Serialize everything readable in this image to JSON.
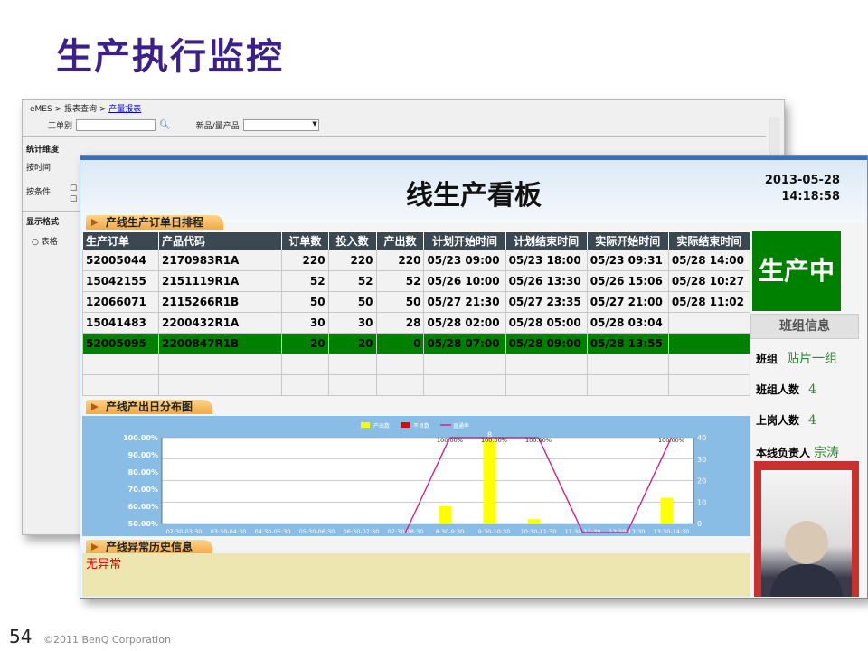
{
  "slide": {
    "title": "生产执行监控",
    "page_number": "54",
    "copyright": "©2011 BenQ Corporation"
  },
  "bg_window": {
    "breadcrumb_prefix": "eMES > 报表查询 > ",
    "breadcrumb_link": "产量报表",
    "order_label": "工单别",
    "product_label": "新品/量产品",
    "section_stats": "统计维度",
    "by_time": "按时间",
    "by_condition": "按条件",
    "section_display": "显示格式",
    "table_option": "表格"
  },
  "board": {
    "title": "线生产看板",
    "date": "2013-05-28",
    "time": "14:18:58",
    "schedule_tab": "产线生产订单日排程",
    "output_tab": "产线产出日分布图",
    "anomaly_tab": "产线异常历史信息",
    "anomaly_text": "无异常",
    "status": "生产中",
    "team_header": "班组信息",
    "team_label": "班组",
    "team_value": "贴片一组",
    "team_size_label": "班组人数",
    "team_size_value": "4",
    "onduty_label": "上岗人数",
    "onduty_value": "4",
    "owner_label": "本线负责人",
    "owner_value": "宗涛"
  },
  "orders": {
    "columns": [
      "生产订单",
      "产品代码",
      "订单数",
      "投入数",
      "产出数",
      "计划开始时间",
      "计划结束时间",
      "实际开始时间",
      "实际结束时间"
    ],
    "rows": [
      [
        "52005044",
        "2170983R1A",
        "220",
        "220",
        "220",
        "05/23 09:00",
        "05/23 18:00",
        "05/23 09:31",
        "05/28 14:00"
      ],
      [
        "15042155",
        "2151119R1A",
        "52",
        "52",
        "52",
        "05/26 10:00",
        "05/26 13:30",
        "05/26 15:06",
        "05/28 10:27"
      ],
      [
        "12066071",
        "2115266R1B",
        "50",
        "50",
        "50",
        "05/27 21:30",
        "05/27 23:35",
        "05/27 21:00",
        "05/28 11:02"
      ],
      [
        "15041483",
        "2200432R1A",
        "30",
        "30",
        "28",
        "05/28 02:00",
        "05/28 05:00",
        "05/28 03:04",
        ""
      ],
      [
        "52005095",
        "2200847R1B",
        "20",
        "20",
        "0",
        "05/28 07:00",
        "05/28 09:00",
        "05/28 13:55",
        ""
      ],
      [
        "",
        "",
        "",
        "",
        "",
        "",
        "",
        "",
        ""
      ],
      [
        "",
        "",
        "",
        "",
        "",
        "",
        "",
        "",
        ""
      ]
    ],
    "highlight_row": 4,
    "highlight_color": "#008000"
  },
  "chart_data": {
    "type": "bar",
    "categories": [
      "02:30-03:30",
      "03:30-04:30",
      "04:30-05:30",
      "05:30-06:30",
      "06:30-07:30",
      "07:30-08:30",
      "8:30-9:30",
      "9:30-10:30",
      "10:30-11:30",
      "11:30-12:30",
      "12:30-13:30",
      "13:30-14:30"
    ],
    "series": [
      {
        "name": "产出数",
        "color": "#ffff00",
        "values": [
          0,
          0,
          0,
          0,
          0,
          0,
          8,
          39,
          2,
          0,
          0,
          12
        ]
      },
      {
        "name": "不良数",
        "color": "#e00000",
        "values": [
          0,
          0,
          0,
          0,
          0,
          0,
          0,
          0,
          0,
          0,
          0,
          0
        ]
      },
      {
        "name": "直通率",
        "color": "#d0208c",
        "type": "line",
        "values": [
          null,
          null,
          null,
          null,
          null,
          0,
          100,
          100,
          100,
          0,
          0,
          100
        ]
      }
    ],
    "bar_value_labels": [
      "0",
      "0",
      "0",
      "0",
      "0",
      "0",
      "0",
      "0",
      "0",
      "0",
      "0",
      "0",
      "0",
      "0",
      "8",
      "0",
      "39",
      "0",
      "2",
      "0",
      "0",
      "0",
      "0",
      "0",
      "12",
      "0"
    ],
    "line_labels": [
      "100.00%",
      "100.00%",
      "100.00%",
      "100.00%"
    ],
    "left_axis": {
      "ticks": [
        "100.00%",
        "90.00%",
        "80.00%",
        "70.00%",
        "60.00%",
        "50.00%"
      ],
      "range": [
        50,
        100
      ]
    },
    "right_axis": {
      "ticks": [
        "40",
        "30",
        "20",
        "10",
        "0"
      ],
      "range": [
        0,
        40
      ]
    },
    "legend_position": "top"
  }
}
